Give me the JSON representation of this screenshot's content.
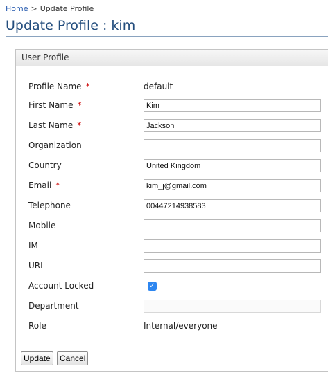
{
  "breadcrumb": {
    "home_label": "Home",
    "separator": ">",
    "current_label": "Update Profile"
  },
  "page": {
    "title": "Update Profile : kim"
  },
  "panel": {
    "header": "User Profile"
  },
  "fields": {
    "profile_name": {
      "label": "Profile Name",
      "required": "*",
      "value": "default"
    },
    "first_name": {
      "label": "First Name",
      "required": "*",
      "value": "Kim"
    },
    "last_name": {
      "label": "Last Name",
      "required": "*",
      "value": "Jackson"
    },
    "organization": {
      "label": "Organization",
      "value": ""
    },
    "country": {
      "label": "Country",
      "value": "United Kingdom"
    },
    "email": {
      "label": "Email",
      "required": "*",
      "value": "kim_j@gmail.com"
    },
    "telephone": {
      "label": "Telephone",
      "value": "00447214938583"
    },
    "mobile": {
      "label": "Mobile",
      "value": ""
    },
    "im": {
      "label": "IM",
      "value": ""
    },
    "url": {
      "label": "URL",
      "value": ""
    },
    "account_locked": {
      "label": "Account Locked",
      "checked": true,
      "check_glyph": "✓"
    },
    "department": {
      "label": "Department",
      "value": ""
    },
    "role": {
      "label": "Role",
      "value": "Internal/everyone"
    }
  },
  "actions": {
    "update_label": "Update",
    "cancel_label": "Cancel"
  },
  "colors": {
    "title": "#234d7d",
    "link": "#2a5db0",
    "required": "#cc0000",
    "checkbox": "#2d86f0"
  }
}
